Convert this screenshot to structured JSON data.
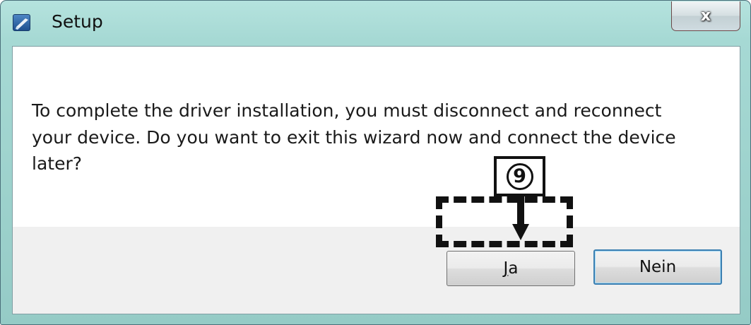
{
  "window": {
    "title": "Setup",
    "close_symbol": "x",
    "icon": "setup-app-icon"
  },
  "dialog": {
    "message_lines": [
      "To complete the driver installation, you must disconnect and reconnect",
      "your device. Do you want to exit this wizard now and connect the device",
      "later?"
    ],
    "buttons": {
      "yes": {
        "mnemonic": "J",
        "rest": "a"
      },
      "no": {
        "label": "Nein"
      }
    }
  },
  "annotation": {
    "step_number": "9",
    "arrow_icon": "down-arrow-icon"
  },
  "colors": {
    "titlebar": "#a6d9d4",
    "footer": "#f0f0f0",
    "default_button_border": "#3c7fb1"
  }
}
